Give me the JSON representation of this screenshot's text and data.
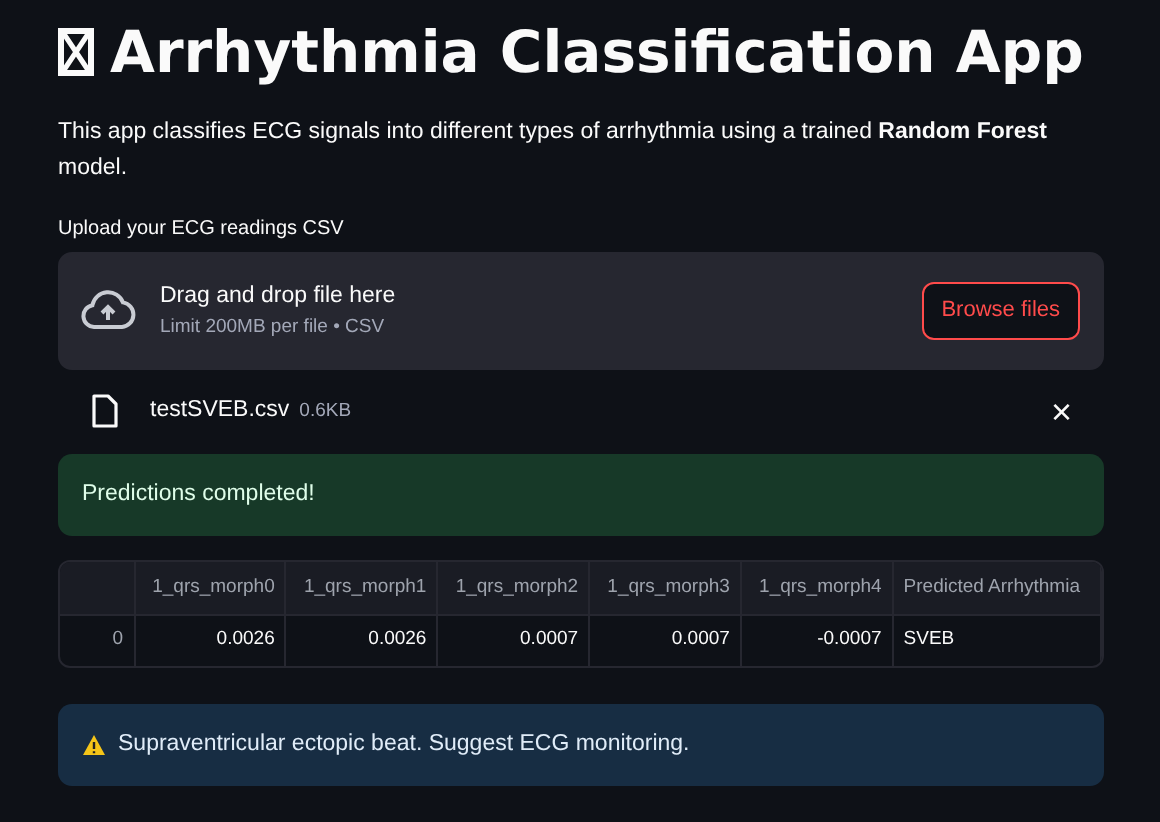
{
  "title": "Arrhythmia Classification App",
  "description": "This app classifies ECG signals into different types of arrhythmia using a trained **Random Forest** model.",
  "uploader": {
    "label": "Upload your ECG readings CSV",
    "drop_text": "Drag and drop file here",
    "limit_text": "Limit 200MB per file • CSV",
    "button": "Browse files"
  },
  "file": {
    "name": "testSVEB.csv",
    "size": "0.6KB",
    "remove": "×"
  },
  "alerts_top": [
    {
      "kind": "success",
      "text": "Predictions completed!"
    }
  ],
  "table": {
    "columns": [
      "1_qrs_morph0",
      "1_qrs_morph1",
      "1_qrs_morph2",
      "1_qrs_morph3",
      "1_qrs_morph4",
      "Predicted Arrhythmia"
    ],
    "rows": [
      {
        "index": "0",
        "cells": [
          "0.0026",
          "0.0026",
          "0.0007",
          "0.0007",
          "-0.0007",
          "SVEB"
        ]
      }
    ]
  },
  "alerts_bottom": [
    {
      "kind": "warning",
      "text": "Supraventricular ectopic beat. Suggest ECG monitoring."
    }
  ]
}
